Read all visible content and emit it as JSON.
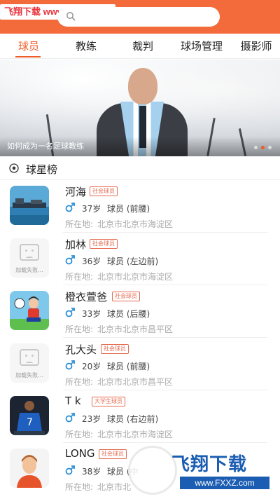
{
  "watermark_top": {
    "text": "飞翔下载 www.FXXZ.com"
  },
  "search": {
    "placeholder": ""
  },
  "tabs": [
    {
      "label": "球员",
      "active": true
    },
    {
      "label": "教练",
      "active": false
    },
    {
      "label": "裁判",
      "active": false
    },
    {
      "label": "球场管理",
      "active": false
    },
    {
      "label": "摄影师",
      "active": false
    }
  ],
  "banner": {
    "caption": "如何成为一名足球教练",
    "page_count": 3,
    "current_page": 2
  },
  "section": {
    "title": "球星榜"
  },
  "players": [
    {
      "name": "河海",
      "badge": "社会球员",
      "age": "37岁",
      "role": "球员 (前腰)",
      "location_label": "所在地:",
      "location": "北京市北京市海淀区",
      "avatar": "harbor-photo"
    },
    {
      "name": "加林",
      "badge": "社会球员",
      "age": "36岁",
      "role": "球员 (左边前)",
      "location_label": "所在地:",
      "location": "北京市北京市海淀区",
      "avatar": "load-failed",
      "avatar_fail_text": "加载失败..."
    },
    {
      "name": "橙衣萱爸",
      "badge": "社会球员",
      "age": "33岁",
      "role": "球员 (后腰)",
      "location_label": "所在地:",
      "location": "北京市北京市昌平区",
      "avatar": "cartoon-player"
    },
    {
      "name": "孔大头",
      "badge": "社会球员",
      "age": "20岁",
      "role": "球员 (前腰)",
      "location_label": "所在地:",
      "location": "北京市北京市昌平区",
      "avatar": "load-failed",
      "avatar_fail_text": "加载失败..."
    },
    {
      "name": "T k",
      "badge": "大学生球员",
      "age": "23岁",
      "role": "球员 (右边前)",
      "location_label": "所在地:",
      "location": "北京市北京市海淀区",
      "avatar": "blue-jersey-photo"
    },
    {
      "name": "LONG",
      "badge": "社会球员",
      "age": "38岁",
      "role": "球员 (中",
      "location_label": "所在地:",
      "location": "北京市北",
      "avatar": "avatar-illustration"
    }
  ],
  "watermark_bottom": {
    "text": "飞翔下载",
    "url": "www.FXXZ.com"
  },
  "colors": {
    "header": "#f36a3b",
    "accent": "#f05a24",
    "male": "#2b8fd6",
    "badge": "#e46a4f"
  }
}
